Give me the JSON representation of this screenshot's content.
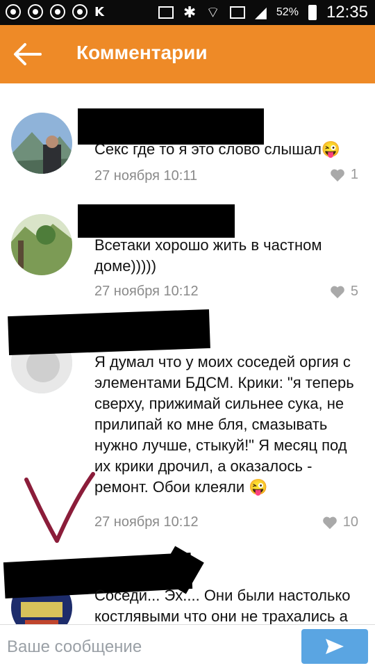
{
  "status_bar": {
    "battery": "52%",
    "time": "12:35",
    "carrier_glyph": "K"
  },
  "header": {
    "title": "Комментарии"
  },
  "comments": [
    {
      "text": "Секс где то я это слово слышал😜",
      "timestamp": "27 ноября 10:11",
      "likes": "1"
    },
    {
      "text": "Всетаки хорошо жить в частном доме)))))",
      "timestamp": "27 ноября 10:12",
      "likes": "5"
    },
    {
      "text": "Я думал что у моих соседей оргия с элементами БДСМ. Крики: \"я теперь сверху, прижимай сильнее сука, не прилипай ко мне бля, смазывать нужно лучше, стыкуй!\" Я месяц под их крики дрочил, а оказалось - ремонт. Обои клеяли 😜",
      "timestamp": "27 ноября 10:12",
      "likes": "10"
    },
    {
      "text": "Соседи... Эх.... Они были настолько костлявыми что они не трахались а",
      "timestamp": "",
      "likes": ""
    }
  ],
  "composer": {
    "placeholder": "Ваше сообщение"
  },
  "colors": {
    "appbar": "#ee8a27",
    "send_button": "#5aa5e2",
    "annotation_mark": "#8b1d3a"
  }
}
